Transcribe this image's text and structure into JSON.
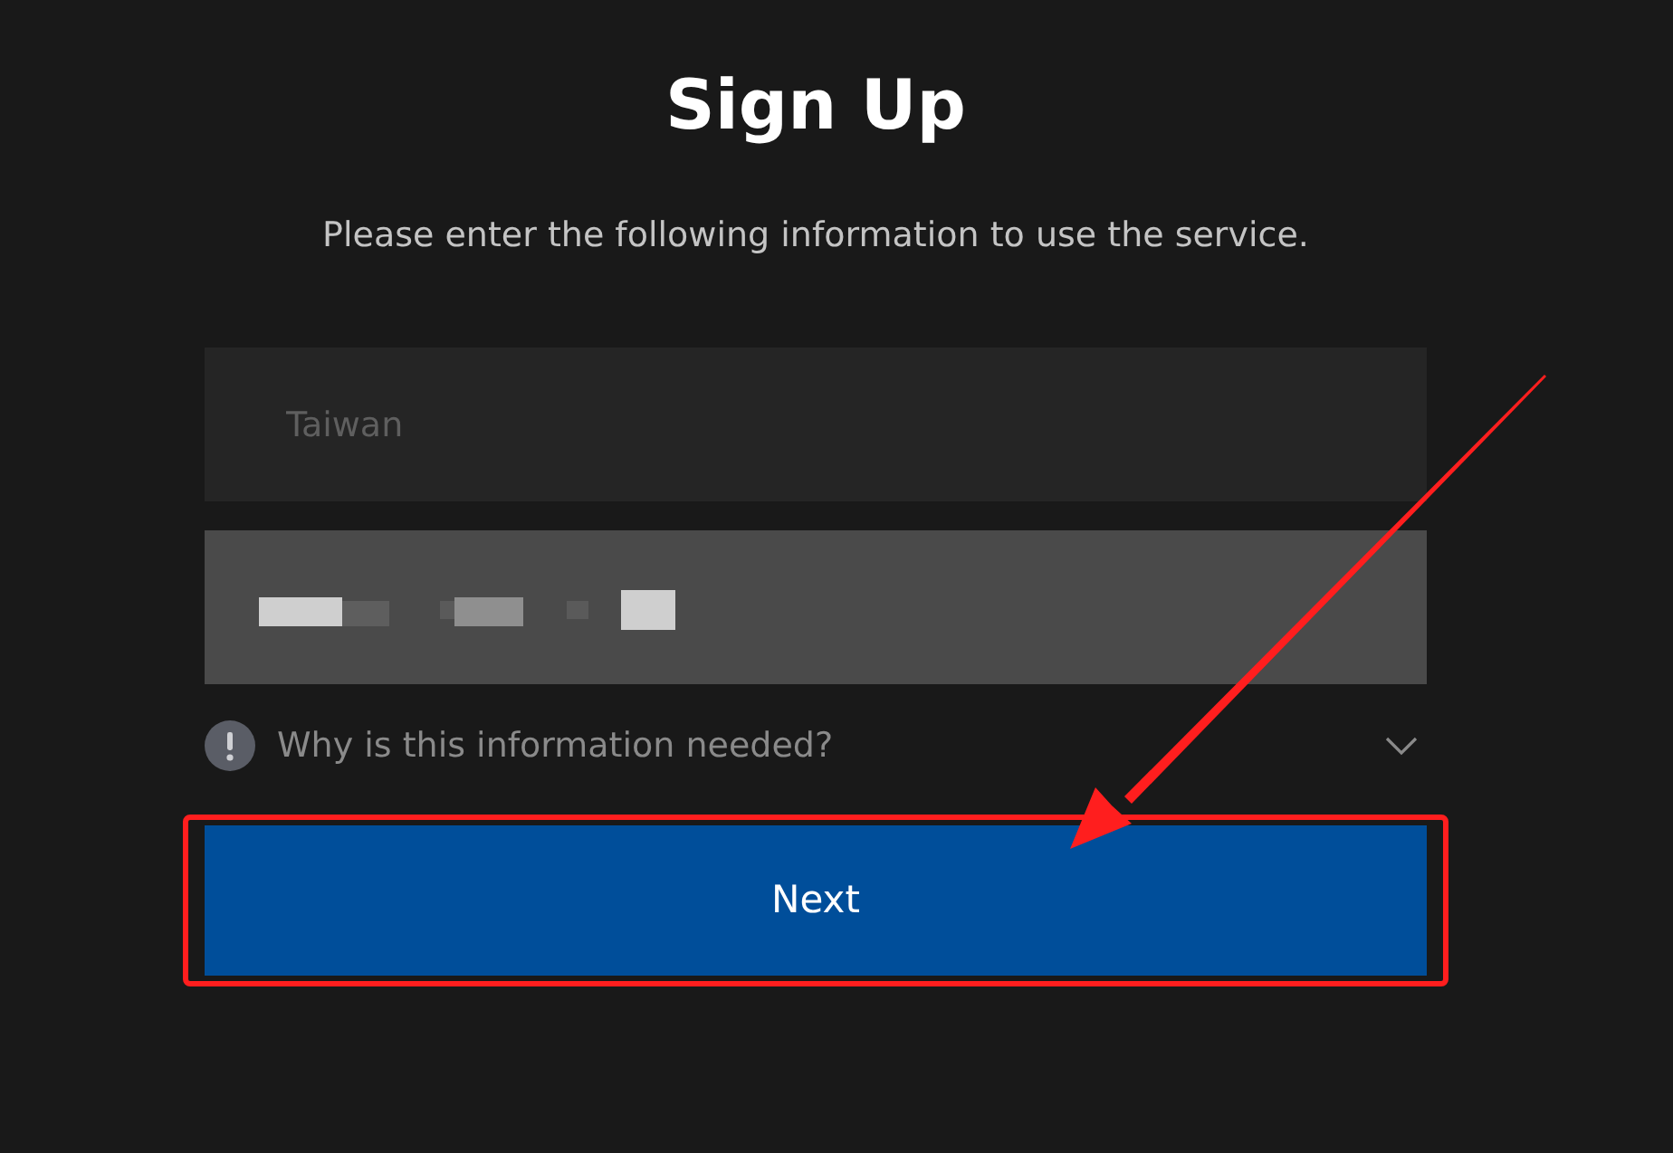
{
  "title": "Sign Up",
  "subtitle": "Please enter the following information to use the service.",
  "fields": [
    {
      "value": "Taiwan",
      "disabled": true,
      "value_redacted": false
    },
    {
      "disabled": false,
      "value_redacted": true
    }
  ],
  "info": {
    "label": "Why is this information needed?",
    "expanded": false
  },
  "buttons": [
    {
      "label": "Next",
      "highlighted": true
    }
  ],
  "annotations": [
    {
      "kind": "arrow"
    }
  ]
}
